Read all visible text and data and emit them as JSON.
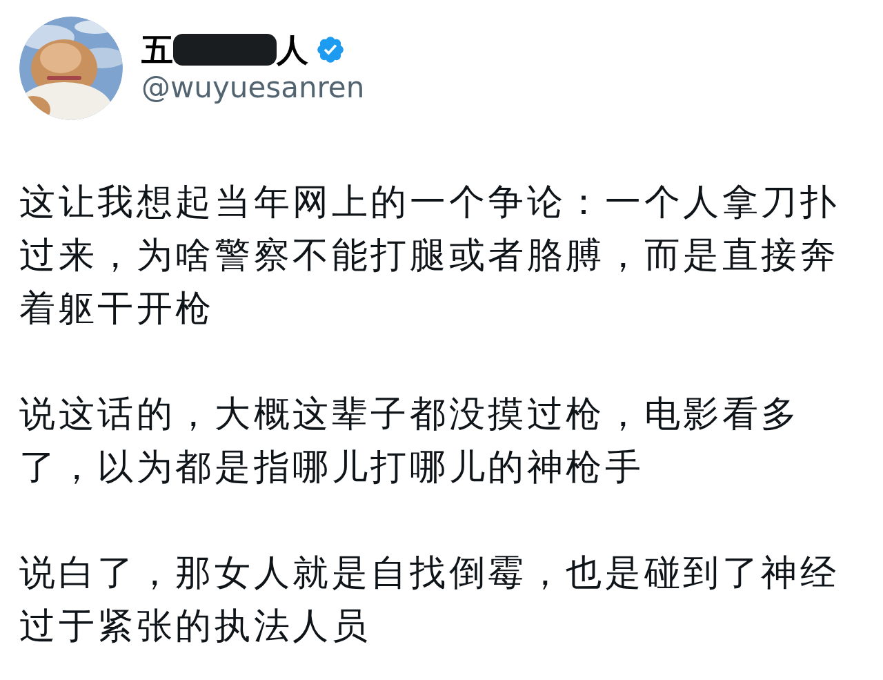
{
  "author": {
    "name_start": "五",
    "name_end": "人",
    "redacted": true,
    "verified": true,
    "handle": "@wuyuesanren"
  },
  "paragraphs": [
    "这让我想起当年网上的一个争论：一个人拿刀扑过来，为啥警察不能打腿或者胳膊，而是直接奔着躯干开枪",
    "说这话的，大概这辈子都没摸过枪，电影看多了，以为都是指哪儿打哪儿的神枪手",
    "说白了，那女人就是自找倒霉，也是碰到了神经过于紧张的执法人员"
  ]
}
